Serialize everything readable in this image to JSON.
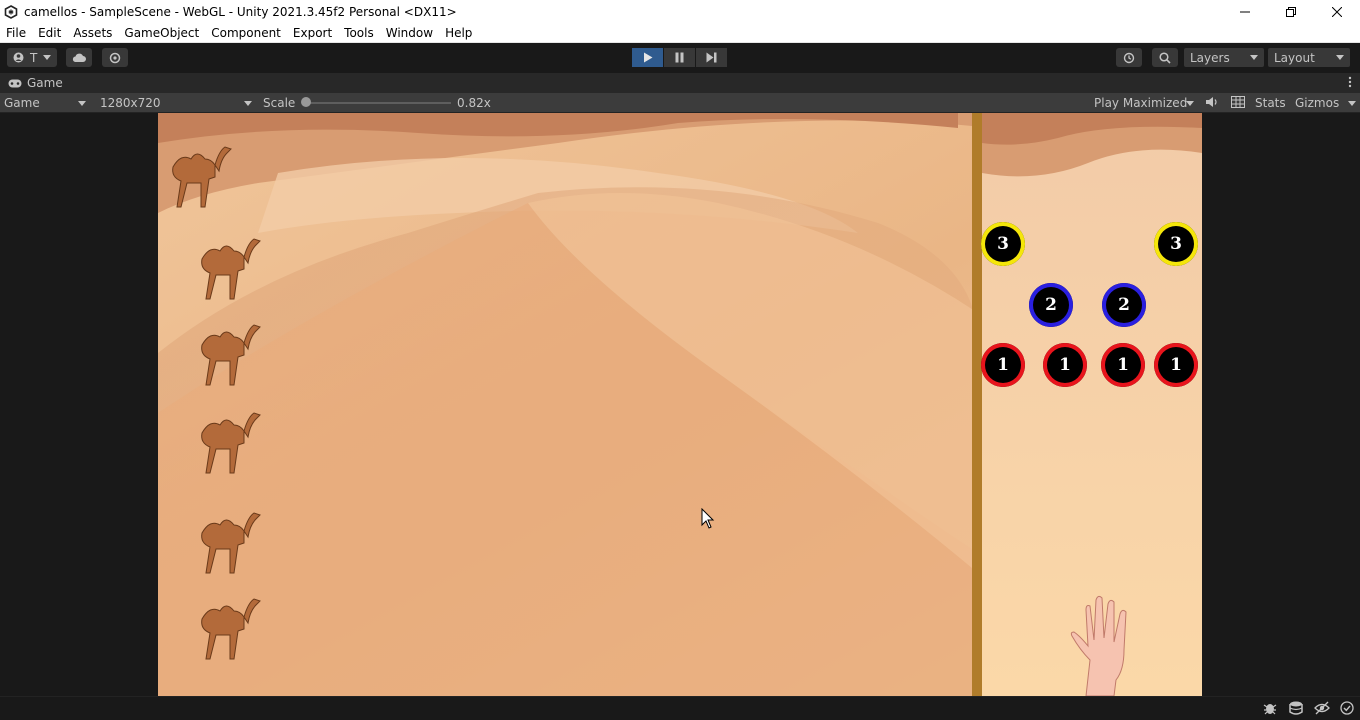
{
  "window": {
    "title": "camellos - SampleScene - WebGL - Unity 2021.3.45f2 Personal <DX11>"
  },
  "menu": [
    "File",
    "Edit",
    "Assets",
    "GameObject",
    "Component",
    "Export",
    "Tools",
    "Window",
    "Help"
  ],
  "toolbar": {
    "account_label": "T",
    "layers_label": "Layers",
    "layout_label": "Layout"
  },
  "tab": {
    "label": "Game"
  },
  "gamebar": {
    "display_label": "Game",
    "resolution_label": "1280x720",
    "scale_label": "Scale",
    "scale_value": "0.82x",
    "play_mode_label": "Play Maximized",
    "stats_label": "Stats",
    "gizmos_label": "Gizmos"
  },
  "game": {
    "camel_count": 6,
    "tokens": [
      {
        "number": "3",
        "ring": "#f5e60a"
      },
      {
        "number": "3",
        "ring": "#f5e60a"
      },
      {
        "number": "2",
        "ring": "#2a1fe0"
      },
      {
        "number": "2",
        "ring": "#2a1fe0"
      },
      {
        "number": "1",
        "ring": "#e8141c"
      },
      {
        "number": "1",
        "ring": "#e8141c"
      },
      {
        "number": "1",
        "ring": "#e8141c"
      },
      {
        "number": "1",
        "ring": "#e8141c"
      }
    ]
  },
  "colors": {
    "play_active": "#2f5b8f",
    "pole": "#b07c2a"
  }
}
